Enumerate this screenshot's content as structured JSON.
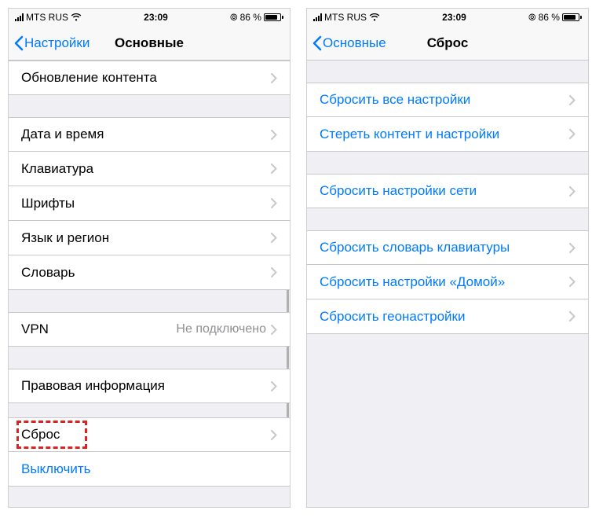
{
  "status": {
    "carrier": "MTS RUS",
    "time": "23:09",
    "battery_pct": "86 %",
    "battery_fill_pct": 86
  },
  "left": {
    "back": "Настройки",
    "title": "Основные",
    "groups": [
      {
        "first": true,
        "cells": [
          {
            "label": "Обновление контента",
            "chev": true
          }
        ]
      },
      {
        "cells": [
          {
            "label": "Дата и время",
            "chev": true
          },
          {
            "label": "Клавиатура",
            "chev": true
          },
          {
            "label": "Шрифты",
            "chev": true
          },
          {
            "label": "Язык и регион",
            "chev": true
          },
          {
            "label": "Словарь",
            "chev": true
          }
        ]
      },
      {
        "cells": [
          {
            "label": "VPN",
            "detail": "Не подключено",
            "chev": true
          }
        ]
      },
      {
        "cells": [
          {
            "label": "Правовая информация",
            "chev": true
          }
        ]
      },
      {
        "small_gap": true,
        "cells": [
          {
            "label": "Сброс",
            "chev": true,
            "highlighted": true
          },
          {
            "label": "Выключить",
            "link": true,
            "chev": false
          }
        ]
      }
    ]
  },
  "right": {
    "back": "Основные",
    "title": "Сброс",
    "groups": [
      {
        "cells": [
          {
            "label": "Сбросить все настройки",
            "link": true
          },
          {
            "label": "Стереть контент и настройки",
            "link": true
          }
        ]
      },
      {
        "cells": [
          {
            "label": "Сбросить настройки сети",
            "link": true
          }
        ]
      },
      {
        "cells": [
          {
            "label": "Сбросить словарь клавиатуры",
            "link": true
          },
          {
            "label": "Сбросить настройки «Домой»",
            "link": true
          },
          {
            "label": "Сбросить геонастройки",
            "link": true
          }
        ]
      }
    ]
  }
}
